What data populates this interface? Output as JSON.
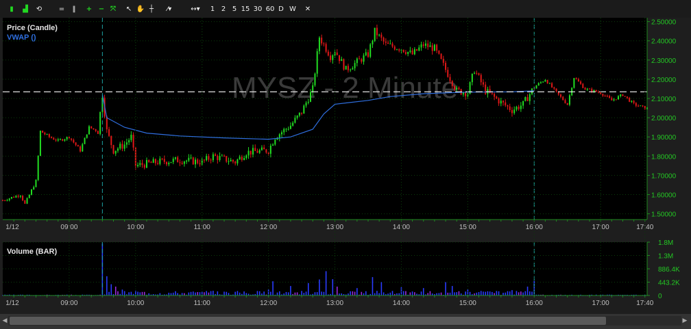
{
  "toolbar": {
    "timeframes": [
      "1",
      "2",
      "5",
      "15",
      "30",
      "60",
      "D",
      "W"
    ]
  },
  "colors": {
    "bg": "#000000",
    "grid": "#0b3d0b",
    "axis": "#1f8a1f",
    "axis_text": "#23c823",
    "time_text": "#c0c0c0",
    "up": "#22dd22",
    "down": "#e01818",
    "vwap": "#2f6fe0",
    "vol_blue": "#2a3cff",
    "vol_purple": "#9a2ae0",
    "cursor": "#1fa3a3",
    "watermark": "#3a3a3a"
  },
  "chart_data": [
    {
      "type": "candlestick",
      "title": "MYSZ - 2 Minute",
      "legend": [
        "Price (Candle)",
        "VWAP ()"
      ],
      "x_axis_labels": [
        "1/12",
        "09:00",
        "10:00",
        "11:00",
        "12:00",
        "13:00",
        "14:00",
        "15:00",
        "16:00",
        "17:00",
        "17:40"
      ],
      "x_range_minutes": [
        480,
        1062
      ],
      "y_tick_labels": [
        "1.50000",
        "1.60000",
        "1.70000",
        "1.80000",
        "1.90000",
        "2.00000",
        "2.10000",
        "2.20000",
        "2.30000",
        "2.40000",
        "2.50000"
      ],
      "ylim": [
        1.47,
        2.52
      ],
      "horizontal_line": 2.135,
      "cursor_times": [
        "09:30",
        "16:00"
      ],
      "price_path": [
        {
          "t": "08:00",
          "p": 1.57
        },
        {
          "t": "08:16",
          "p": 1.6
        },
        {
          "t": "08:20",
          "p": 1.55
        },
        {
          "t": "08:30",
          "p": 1.67
        },
        {
          "t": "08:34",
          "p": 1.93
        },
        {
          "t": "08:42",
          "p": 1.9
        },
        {
          "t": "08:50",
          "p": 1.88
        },
        {
          "t": "09:00",
          "p": 1.9
        },
        {
          "t": "09:10",
          "p": 1.83
        },
        {
          "t": "09:18",
          "p": 1.95
        },
        {
          "t": "09:26",
          "p": 1.93
        },
        {
          "t": "09:30",
          "p": 2.12
        },
        {
          "t": "09:34",
          "p": 1.93
        },
        {
          "t": "09:40",
          "p": 1.83
        },
        {
          "t": "09:50",
          "p": 1.86
        },
        {
          "t": "09:56",
          "p": 1.9
        },
        {
          "t": "10:00",
          "p": 1.75
        },
        {
          "t": "10:20",
          "p": 1.77
        },
        {
          "t": "10:40",
          "p": 1.78
        },
        {
          "t": "11:00",
          "p": 1.77
        },
        {
          "t": "11:10",
          "p": 1.8
        },
        {
          "t": "11:30",
          "p": 1.77
        },
        {
          "t": "11:40",
          "p": 1.82
        },
        {
          "t": "12:00",
          "p": 1.83
        },
        {
          "t": "12:06",
          "p": 1.9
        },
        {
          "t": "12:20",
          "p": 1.96
        },
        {
          "t": "12:30",
          "p": 2.03
        },
        {
          "t": "12:40",
          "p": 2.15
        },
        {
          "t": "12:46",
          "p": 2.42
        },
        {
          "t": "12:56",
          "p": 2.32
        },
        {
          "t": "13:00",
          "p": 2.35
        },
        {
          "t": "13:10",
          "p": 2.25
        },
        {
          "t": "13:30",
          "p": 2.33
        },
        {
          "t": "13:36",
          "p": 2.45
        },
        {
          "t": "13:46",
          "p": 2.38
        },
        {
          "t": "14:00",
          "p": 2.36
        },
        {
          "t": "14:10",
          "p": 2.33
        },
        {
          "t": "14:20",
          "p": 2.38
        },
        {
          "t": "14:30",
          "p": 2.36
        },
        {
          "t": "14:40",
          "p": 2.25
        },
        {
          "t": "14:50",
          "p": 2.14
        },
        {
          "t": "15:00",
          "p": 2.13
        },
        {
          "t": "15:06",
          "p": 2.25
        },
        {
          "t": "15:16",
          "p": 2.14
        },
        {
          "t": "15:30",
          "p": 2.08
        },
        {
          "t": "15:40",
          "p": 2.04
        },
        {
          "t": "15:50",
          "p": 2.07
        },
        {
          "t": "16:00",
          "p": 2.16
        },
        {
          "t": "16:10",
          "p": 2.2
        },
        {
          "t": "16:20",
          "p": 2.13
        },
        {
          "t": "16:30",
          "p": 2.07
        },
        {
          "t": "16:36",
          "p": 2.21
        },
        {
          "t": "16:46",
          "p": 2.15
        },
        {
          "t": "17:00",
          "p": 2.13
        },
        {
          "t": "17:10",
          "p": 2.09
        },
        {
          "t": "17:20",
          "p": 2.12
        },
        {
          "t": "17:30",
          "p": 2.07
        },
        {
          "t": "17:40",
          "p": 2.05
        }
      ],
      "vwap_path": [
        {
          "t": "09:30",
          "p": 2.12
        },
        {
          "t": "09:34",
          "p": 2.0
        },
        {
          "t": "09:50",
          "p": 1.95
        },
        {
          "t": "10:10",
          "p": 1.92
        },
        {
          "t": "10:40",
          "p": 1.905
        },
        {
          "t": "11:20",
          "p": 1.895
        },
        {
          "t": "12:00",
          "p": 1.888
        },
        {
          "t": "12:20",
          "p": 1.9
        },
        {
          "t": "12:40",
          "p": 1.94
        },
        {
          "t": "12:50",
          "p": 2.02
        },
        {
          "t": "13:00",
          "p": 2.07
        },
        {
          "t": "13:30",
          "p": 2.09
        },
        {
          "t": "13:50",
          "p": 2.11
        },
        {
          "t": "14:20",
          "p": 2.125
        },
        {
          "t": "15:00",
          "p": 2.133
        },
        {
          "t": "15:40",
          "p": 2.135
        },
        {
          "t": "16:00",
          "p": 2.14
        }
      ]
    },
    {
      "type": "bar",
      "title": "Volume (BAR)",
      "y_tick_labels": [
        "1.8M",
        "1.3M",
        "886.4K",
        "443.2K",
        "0"
      ],
      "ylim": [
        0,
        1800000
      ],
      "spikes": [
        {
          "t": "09:30",
          "v": 1750000
        },
        {
          "t": "09:34",
          "v": 650000
        },
        {
          "t": "09:38",
          "v": 380000
        },
        {
          "t": "09:42",
          "v": 300000
        },
        {
          "t": "09:48",
          "v": 200000
        },
        {
          "t": "10:00",
          "v": 160000
        },
        {
          "t": "10:06",
          "v": 120000
        },
        {
          "t": "12:00",
          "v": 200000
        },
        {
          "t": "12:04",
          "v": 480000
        },
        {
          "t": "12:20",
          "v": 320000
        },
        {
          "t": "12:36",
          "v": 420000
        },
        {
          "t": "12:46",
          "v": 540000
        },
        {
          "t": "12:52",
          "v": 820000
        },
        {
          "t": "12:58",
          "v": 550000
        },
        {
          "t": "13:02",
          "v": 300000
        },
        {
          "t": "13:20",
          "v": 250000
        },
        {
          "t": "13:34",
          "v": 620000
        },
        {
          "t": "13:42",
          "v": 450000
        },
        {
          "t": "14:00",
          "v": 280000
        },
        {
          "t": "14:20",
          "v": 250000
        },
        {
          "t": "14:40",
          "v": 450000
        },
        {
          "t": "14:46",
          "v": 320000
        },
        {
          "t": "15:00",
          "v": 200000
        },
        {
          "t": "15:40",
          "v": 180000
        },
        {
          "t": "15:54",
          "v": 300000
        },
        {
          "t": "16:00",
          "v": 500000
        }
      ]
    }
  ]
}
